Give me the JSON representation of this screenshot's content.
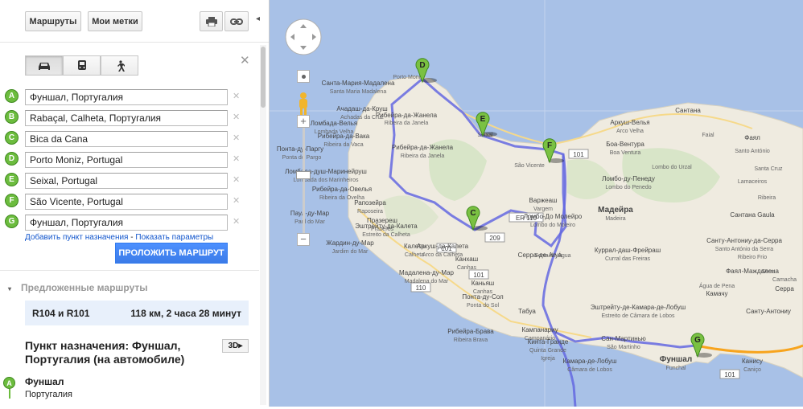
{
  "toolbar": {
    "routes_label": "Маршруты",
    "mylabels_label": "Мои метки",
    "print_icon": "printer-icon",
    "link_icon": "link-icon"
  },
  "modes": [
    {
      "icon": "car-icon",
      "active": true
    },
    {
      "icon": "bus-icon",
      "active": false
    },
    {
      "icon": "walk-icon",
      "active": false
    }
  ],
  "waypoints": [
    {
      "letter": "A",
      "value": "Фуншал, Португалия"
    },
    {
      "letter": "B",
      "value": "Rabaçal, Calheta, Португалия"
    },
    {
      "letter": "C",
      "value": "Bica da Cana"
    },
    {
      "letter": "D",
      "value": "Porto Moniz, Portugal"
    },
    {
      "letter": "E",
      "value": "Seixal, Portugal"
    },
    {
      "letter": "F",
      "value": "São Vicente, Portugal"
    },
    {
      "letter": "G",
      "value": "Фуншал, Португалия"
    }
  ],
  "links": {
    "add_destination": "Добавить пункт назначения",
    "separator": " - ",
    "show_options": "Показать параметры"
  },
  "route_button": "ПРОЛОЖИТЬ МАРШРУТ",
  "suggested_label": "Предложенные маршруты",
  "suggested_route": {
    "roads": "R104 и R101",
    "summary": "118 км, 2 часа 28 минут"
  },
  "destination_title": "Пункт назначения: Фуншал, Португалия (на автомобиле)",
  "btn_3d": "3D",
  "start": {
    "letter": "A",
    "name": "Фуншал",
    "country": "Португалия"
  },
  "map": {
    "colors": {
      "sea": "#a8c1e7",
      "land": "#efebe0",
      "route": "#6468e0",
      "highway": "#f7a41e"
    },
    "markers": [
      "C",
      "D",
      "E",
      "F",
      "G"
    ],
    "road_numbers": [
      "101",
      "101",
      "101",
      "209",
      "ER 110",
      "110",
      "101"
    ],
    "labels": [
      "Санта-Мария-Мадалена",
      "Santa Maria Madalena",
      "Porto Moniz",
      "Рибейра-да-Жанела",
      "Ribeira da Janela",
      "Seixal",
      "Ачадаш-да-Круш",
      "Achadas da Cruz",
      "Понта-ду-Паргу",
      "Ponta do Pargo",
      "Ломбада-Велья",
      "Lombada Velha",
      "Рибейра-да-Вака",
      "Ribeira da Vaca",
      "Рибейра-да-Жанела",
      "Ribeira da Janela",
      "Ломбада-душ-Маринейруш",
      "Lombada dos Marinheiros",
      "Рибейра-да-Овелья",
      "Ribeira da Ovelha",
      "Паул-ду-Мар",
      "Paul do Mar",
      "Рапозейра",
      "Raposeira",
      "Празереш",
      "Prazeres",
      "Эштрейту-да-Калета",
      "Estreito da Calheta",
      "Жардин-ду-Мар",
      "Jardim do Mar",
      "Калета",
      "Calheta",
      "Аркуш-да-Калета",
      "Arco da Calheta",
      "Канхаш",
      "Canhas",
      "Мадалена-ду-Мар",
      "Madalena do Mar",
      "Каньяш",
      "Canhas",
      "Понта-ду-Сол",
      "Ponta do Sol",
      "Рибейра-Брава",
      "Ribeira Brava",
      "Табуа",
      "Кампанариу",
      "Campanário",
      "Кинта-Гранде",
      "Quinta Grande",
      "Igreja",
      "São Vicente",
      "Варжеаш",
      "Vargem",
      "Ломбо-До Молейро",
      "Lombo do Moleiro",
      "Serra de Água",
      "Аркуш-Велья",
      "Arco Velha",
      "Боа-Вентура",
      "Boa Ventura",
      "Сантана",
      "Lombo do Urzal",
      "Ломбо-ду-Пенеду",
      "Lombo do Penedo",
      "Мадейра",
      "Madeira",
      "Куррал-даш-Фрейраш",
      "Curral das Freiras",
      "Эштрейту-де-Камара-де-Лобуш",
      "Estreito de Câmara de Lobos",
      "Сан-Мартинью",
      "São Martinho",
      "Камара-де-Лобуш",
      "Câmara de Lobos",
      "Фуншал",
      "Funchal",
      "Канису",
      "Caniço",
      "Faial",
      "Фаял",
      "Серра-де-Агуа",
      "Санту-Антониу-да-Серра",
      "Santo António da Serra",
      "Santa Cruz",
      "Ribeira",
      "Lamaceiros",
      "Фаял-Маждалена",
      "Ribeiro Frio",
      "Água de Pena",
      "Камачу",
      "Camacha",
      "Серра",
      "Serra",
      "Санту-Антониу",
      "Santo António",
      "Сантана Gaula",
      "Санта-Круш",
      "Faial",
      "Santana"
    ]
  }
}
